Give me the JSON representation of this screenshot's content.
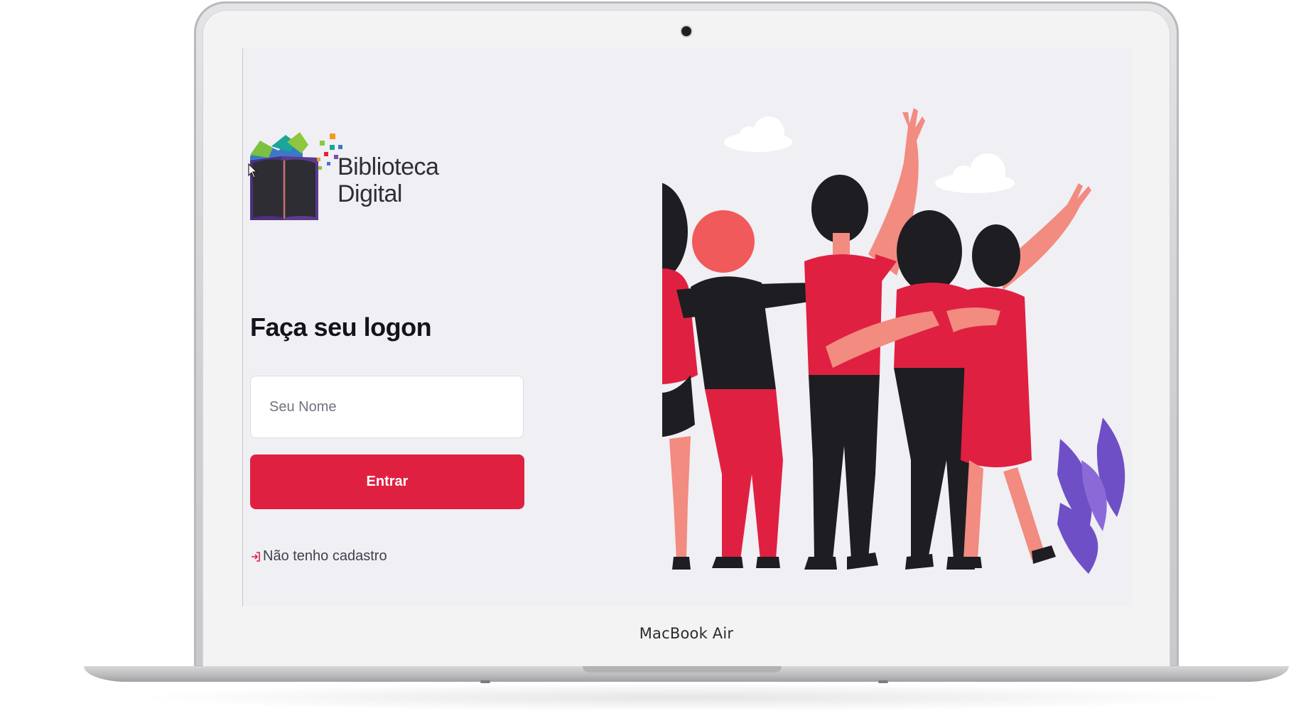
{
  "device": {
    "label": "MacBook Air"
  },
  "logo": {
    "line1": "Biblioteca",
    "line2": "Digital"
  },
  "login": {
    "title": "Faça seu logon",
    "name_placeholder": "Seu Nome",
    "name_value": "",
    "submit_label": "Entrar",
    "register_link": "Não tenho cadastro",
    "register_icon": "log-in-icon"
  },
  "colors": {
    "accent": "#e02041",
    "background": "#f0eff4",
    "heading": "#13131a",
    "link_text": "#41414d"
  },
  "illustration": {
    "icon": "group-of-friends-illustration"
  }
}
